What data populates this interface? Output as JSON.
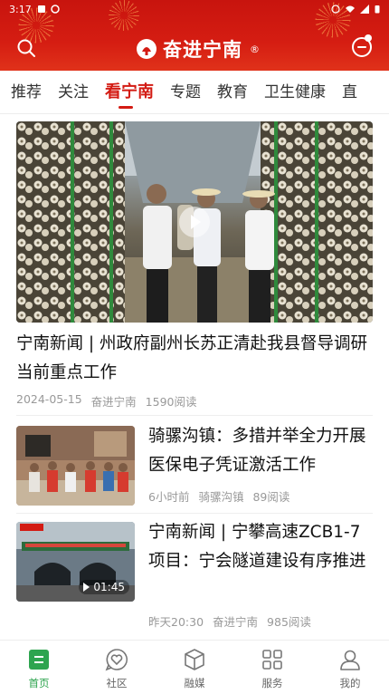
{
  "status_bar": {
    "time": "3:17"
  },
  "header": {
    "app_name": "奋进宁南",
    "reg_mark": "®"
  },
  "tabs": [
    {
      "label": "推荐"
    },
    {
      "label": "关注"
    },
    {
      "label": "看宁南"
    },
    {
      "label": "专题"
    },
    {
      "label": "教育"
    },
    {
      "label": "卫生健康"
    },
    {
      "label": "直"
    }
  ],
  "active_tab": "看宁南",
  "feed": {
    "hero": {
      "title": "宁南新闻 | 州政府副州长苏正清赴我县督导调研当前重点工作",
      "date": "2024-05-15",
      "source": "奋进宁南",
      "reads": "1590阅读"
    },
    "items": [
      {
        "title": "骑骡沟镇：多措并举全力开展医保电子凭证激活工作",
        "time": "6小时前",
        "source": "骑骡沟镇",
        "reads": "89阅读"
      },
      {
        "title": "宁南新闻 | 宁攀高速ZCB1-7项目：宁会隧道建设有序推进",
        "time": "昨天20:30",
        "source": "奋进宁南",
        "reads": "985阅读",
        "duration": "01:45"
      }
    ]
  },
  "bottom_nav": [
    {
      "label": "首页",
      "icon": "home-icon"
    },
    {
      "label": "社区",
      "icon": "heart-chat-icon"
    },
    {
      "label": "融媒",
      "icon": "cube-icon"
    },
    {
      "label": "服务",
      "icon": "grid-icon"
    },
    {
      "label": "我的",
      "icon": "user-icon"
    }
  ],
  "colors": {
    "brand_red": "#d31b13",
    "nav_active_green": "#2ea44f"
  }
}
